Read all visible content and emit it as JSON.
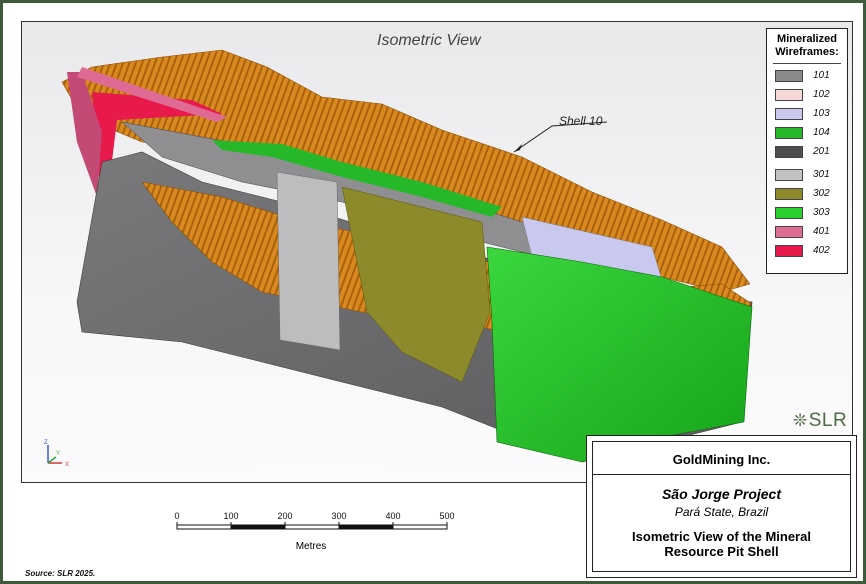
{
  "view": {
    "title": "Isometric View",
    "shell_label": "Shell 10"
  },
  "legend": {
    "title": "Mineralized Wireframes:",
    "items": [
      {
        "code": "101",
        "color": "#8a8a8a"
      },
      {
        "code": "102",
        "color": "#f6d8d6"
      },
      {
        "code": "103",
        "color": "#c9c9ef"
      },
      {
        "code": "104",
        "color": "#27b82a"
      },
      {
        "code": "201",
        "color": "#4d4d4d"
      },
      {
        "code": "301",
        "color": "#c2c2c2"
      },
      {
        "code": "302",
        "color": "#8c8a2a"
      },
      {
        "code": "303",
        "color": "#28d12d"
      },
      {
        "code": "401",
        "color": "#df6a93"
      },
      {
        "code": "402",
        "color": "#e8194b"
      }
    ]
  },
  "axes": {
    "z": "Z",
    "y": "Y",
    "x": "X"
  },
  "logo": {
    "text": "SLR"
  },
  "titlebox": {
    "company": "GoldMining Inc.",
    "project": "São Jorge Project",
    "location": "Pará State, Brazil",
    "figure_title_line1": "Isometric View of the Mineral",
    "figure_title_line2": "Resource Pit Shell"
  },
  "scale": {
    "ticks": [
      "0",
      "100",
      "200",
      "300",
      "400",
      "500"
    ],
    "unit": "Metres"
  },
  "source": "Source:  SLR 2025.",
  "colors": {
    "pit_shell": "#d9891e",
    "host_grey": "#6e6e70",
    "frame_border": "#3f5a3a"
  }
}
